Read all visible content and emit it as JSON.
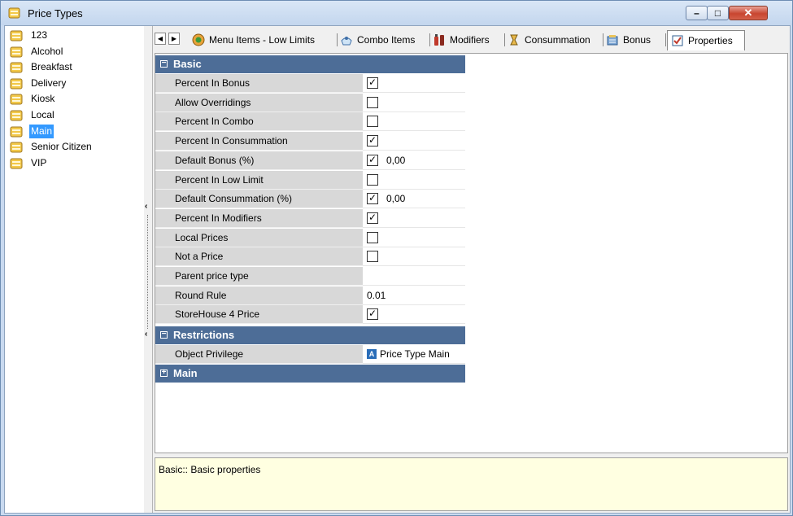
{
  "window": {
    "title": "Price Types",
    "minimize_glyph": "–",
    "maximize_glyph": "□",
    "close_glyph": "✕"
  },
  "price_types": [
    {
      "label": "123"
    },
    {
      "label": "Alcohol"
    },
    {
      "label": "Breakfast"
    },
    {
      "label": "Delivery"
    },
    {
      "label": "Kiosk"
    },
    {
      "label": "Local"
    },
    {
      "label": "Main",
      "selected": true
    },
    {
      "label": "Senior Citizen"
    },
    {
      "label": "VIP"
    }
  ],
  "splitter": {
    "collapse_glyph": "‹"
  },
  "tabs": {
    "prev_glyph": "◀",
    "next_glyph": "▶",
    "items": [
      {
        "label": "Menu Items - Low Limits",
        "icon": "low-limits-icon"
      },
      {
        "label": "Combo Items",
        "icon": "combo-items-icon"
      },
      {
        "label": "Modifiers",
        "icon": "modifiers-icon"
      },
      {
        "label": "Consummation",
        "icon": "consummation-icon"
      },
      {
        "label": "Bonus",
        "icon": "bonus-icon"
      },
      {
        "label": "Properties",
        "icon": "properties-icon",
        "active": true
      }
    ]
  },
  "categories": {
    "basic": {
      "label": "Basic",
      "toggle": "−"
    },
    "restrictions": {
      "label": "Restrictions",
      "toggle": "−"
    },
    "main": {
      "label": "Main",
      "toggle": "+"
    }
  },
  "properties": [
    {
      "name": "Percent In Bonus",
      "checked": true,
      "value": ""
    },
    {
      "name": "Allow Overridings",
      "checked": false,
      "value": ""
    },
    {
      "name": "Percent In Combo",
      "checked": false,
      "value": ""
    },
    {
      "name": "Percent In Consummation",
      "checked": true,
      "value": ""
    },
    {
      "name": "Default Bonus (%)",
      "checked": true,
      "value": "0,00"
    },
    {
      "name": "Percent In Low Limit",
      "checked": false,
      "value": ""
    },
    {
      "name": "Default Consummation (%)",
      "checked": true,
      "value": "0,00"
    },
    {
      "name": "Percent In Modifiers",
      "checked": true,
      "value": ""
    },
    {
      "name": "Local Prices",
      "checked": false,
      "value": ""
    },
    {
      "name": "Not a Price",
      "checked": false,
      "value": ""
    },
    {
      "name": "Parent price type",
      "value": ""
    },
    {
      "name": "Round Rule",
      "value": "0.01"
    },
    {
      "name": "StoreHouse 4 Price",
      "checked": true,
      "value": ""
    }
  ],
  "restrictions": {
    "name": "Object Privilege",
    "icon_letter": "A",
    "value": "Price Type Main"
  },
  "description": "Basic:: Basic properties",
  "check_glyph": "✓"
}
